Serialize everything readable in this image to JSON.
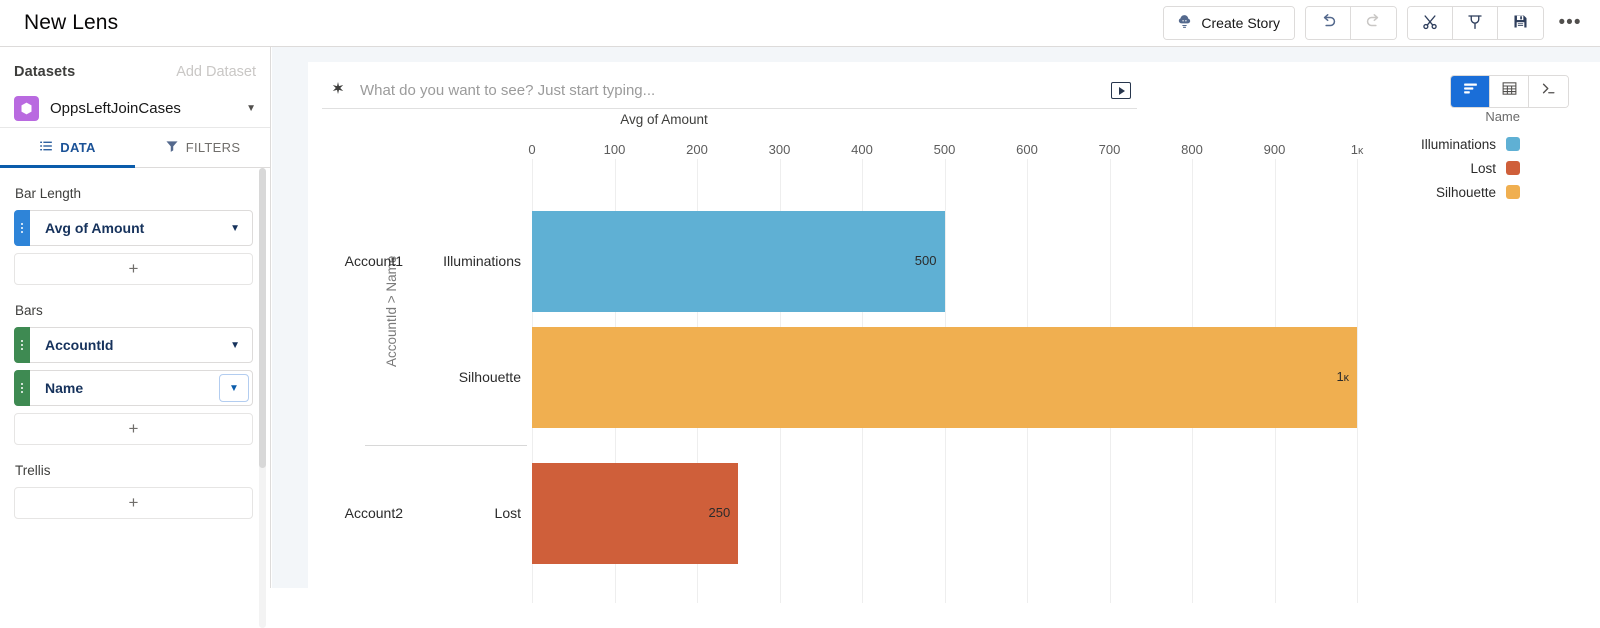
{
  "topbar": {
    "title": "New Lens",
    "create_story_label": "Create Story",
    "buttons": [
      {
        "name": "undo-button",
        "icon": "undo-icon",
        "disabled": false
      },
      {
        "name": "redo-button",
        "icon": "redo-icon",
        "disabled": true
      },
      {
        "name": "clip-button",
        "icon": "scissors-icon",
        "disabled": false
      },
      {
        "name": "pin-button",
        "icon": "pin-icon",
        "disabled": false
      },
      {
        "name": "save-button",
        "icon": "save-disk-icon",
        "disabled": false
      }
    ],
    "more_label": "•••"
  },
  "sidebar": {
    "datasets_label": "Datasets",
    "add_dataset_label": "Add Dataset",
    "dataset_name": "OppsLeftJoinCases",
    "dataset_icon_color": "#b96ae0",
    "tabs": [
      {
        "label": "DATA",
        "icon": "list-icon",
        "active": true
      },
      {
        "label": "FILTERS",
        "icon": "funnel-icon",
        "active": false
      }
    ],
    "sections": [
      {
        "label": "Bar Length",
        "fields": [
          {
            "name": "Avg of Amount",
            "accent": "#2e84d8",
            "caret_boxed": false
          }
        ],
        "add_label": "+"
      },
      {
        "label": "Bars",
        "fields": [
          {
            "name": "AccountId",
            "accent": "#3e8a52",
            "caret_boxed": false
          },
          {
            "name": "Name",
            "accent": "#3e8a52",
            "caret_boxed": true
          }
        ],
        "add_label": "+"
      },
      {
        "label": "Trellis",
        "fields": [],
        "add_label": "+"
      }
    ]
  },
  "main": {
    "search_placeholder": "What do you want to see? Just start typing...",
    "spark_icon": "sparkle-icon",
    "run_button_icon": "play-icon",
    "view_toggle": [
      {
        "name": "chart-view",
        "icon": "bar-chart-icon",
        "selected": true
      },
      {
        "name": "table-view",
        "icon": "grid-table-icon",
        "selected": false
      },
      {
        "name": "query-view",
        "icon": "code-prompt-icon",
        "selected": false
      }
    ]
  },
  "chart_data": {
    "type": "bar",
    "orientation": "horizontal",
    "title": "",
    "xlabel": "Avg of Amount",
    "ylabel": "AccountId > Name",
    "xlim": [
      0,
      1000
    ],
    "xticks": [
      0,
      100,
      200,
      300,
      400,
      500,
      600,
      700,
      800,
      900,
      1000
    ],
    "xtick_labels": [
      "0",
      "100",
      "200",
      "300",
      "400",
      "500",
      "600",
      "700",
      "800",
      "900",
      "1ᴋ"
    ],
    "grid": true,
    "legend_title": "Name",
    "legend_position": "right",
    "groups": [
      {
        "label": "Account1",
        "categories": [
          "Illuminations",
          "Silhouette"
        ]
      },
      {
        "label": "Account2",
        "categories": [
          "Lost"
        ]
      }
    ],
    "categories": [
      "Illuminations",
      "Silhouette",
      "Lost"
    ],
    "values": [
      500,
      1000,
      250
    ],
    "value_labels": [
      "500",
      "1ᴋ",
      "250"
    ],
    "colors": [
      "#5fb0d4",
      "#f0af50",
      "#cf5f3a"
    ],
    "legend": [
      {
        "name": "Illuminations",
        "color": "#5fb0d4"
      },
      {
        "name": "Lost",
        "color": "#cf5f3a"
      },
      {
        "name": "Silhouette",
        "color": "#f0af50"
      }
    ]
  }
}
